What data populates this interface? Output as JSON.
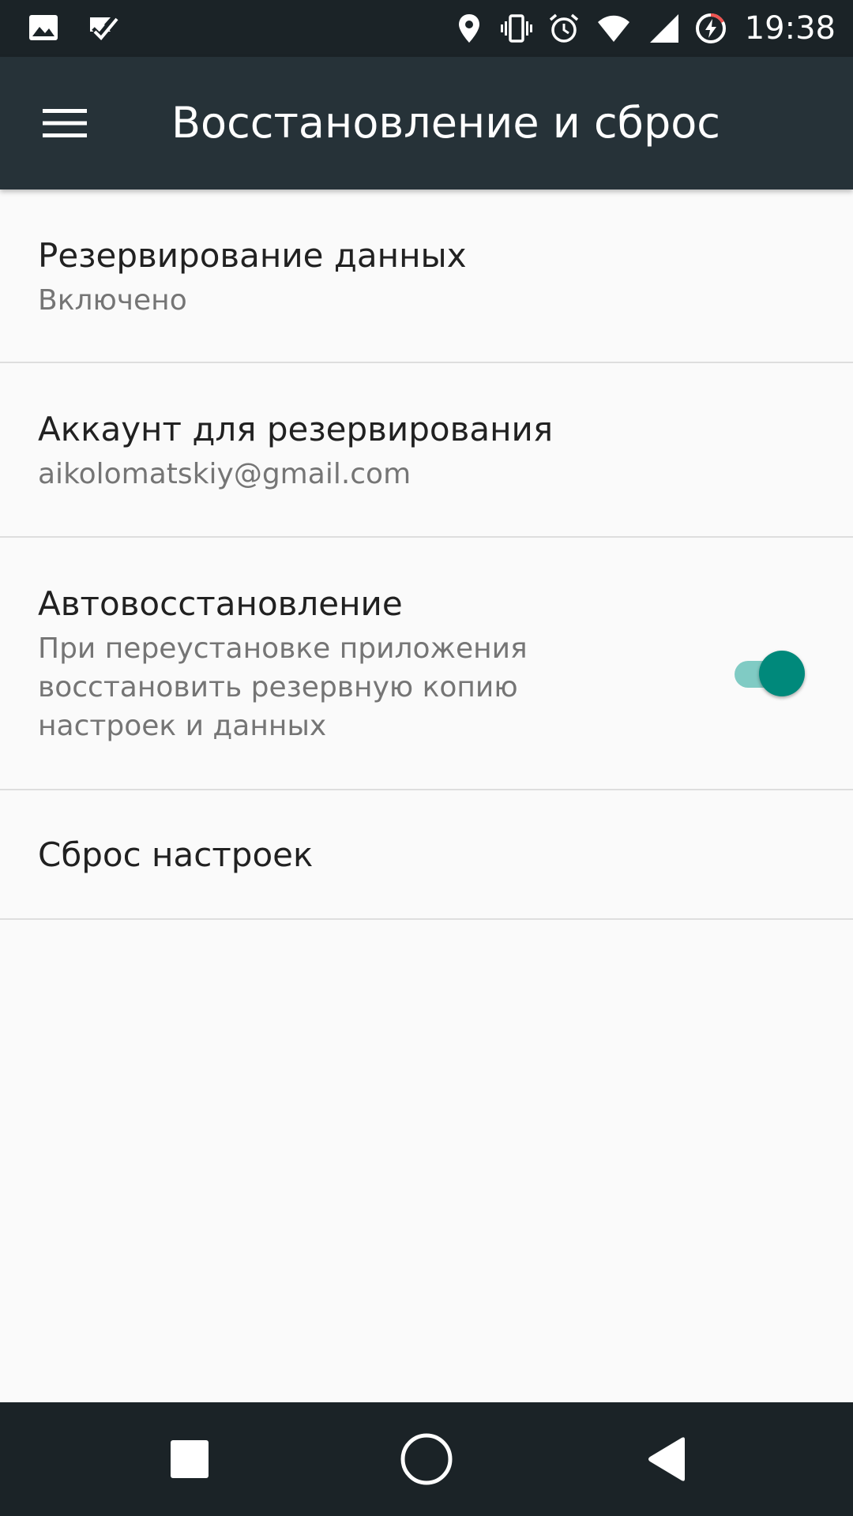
{
  "status_bar": {
    "time": "19:38",
    "left_icons": [
      "gallery-notification-icon",
      "task-done-notification-icon"
    ],
    "right_icons": [
      "location-icon",
      "vibrate-icon",
      "alarm-icon",
      "wifi-icon",
      "cellular-signal-icon",
      "battery-charging-icon"
    ]
  },
  "app_bar": {
    "title": "Восстановление и сброс",
    "menu_icon": "hamburger-menu-icon"
  },
  "preferences": [
    {
      "id": "backup",
      "title": "Резервирование данных",
      "summary": "Включено"
    },
    {
      "id": "account",
      "title": "Аккаунт для резервирования",
      "summary": "aikolomatskiy@gmail.com"
    },
    {
      "id": "autorestore",
      "title": "Автовосстановление",
      "summary": "При переустановке приложения восстановить резервную копию настроек и данных",
      "switch_on": true
    },
    {
      "id": "reset",
      "title": "Сброс настроек"
    }
  ],
  "colors": {
    "status_bar": "#1b2327",
    "app_bar": "#263238",
    "accent": "#00897b",
    "accent_track": "#80cbc4",
    "background": "#fafafa"
  },
  "nav_bar": {
    "icons": [
      "recents-square-icon",
      "home-circle-icon",
      "back-triangle-icon"
    ]
  }
}
